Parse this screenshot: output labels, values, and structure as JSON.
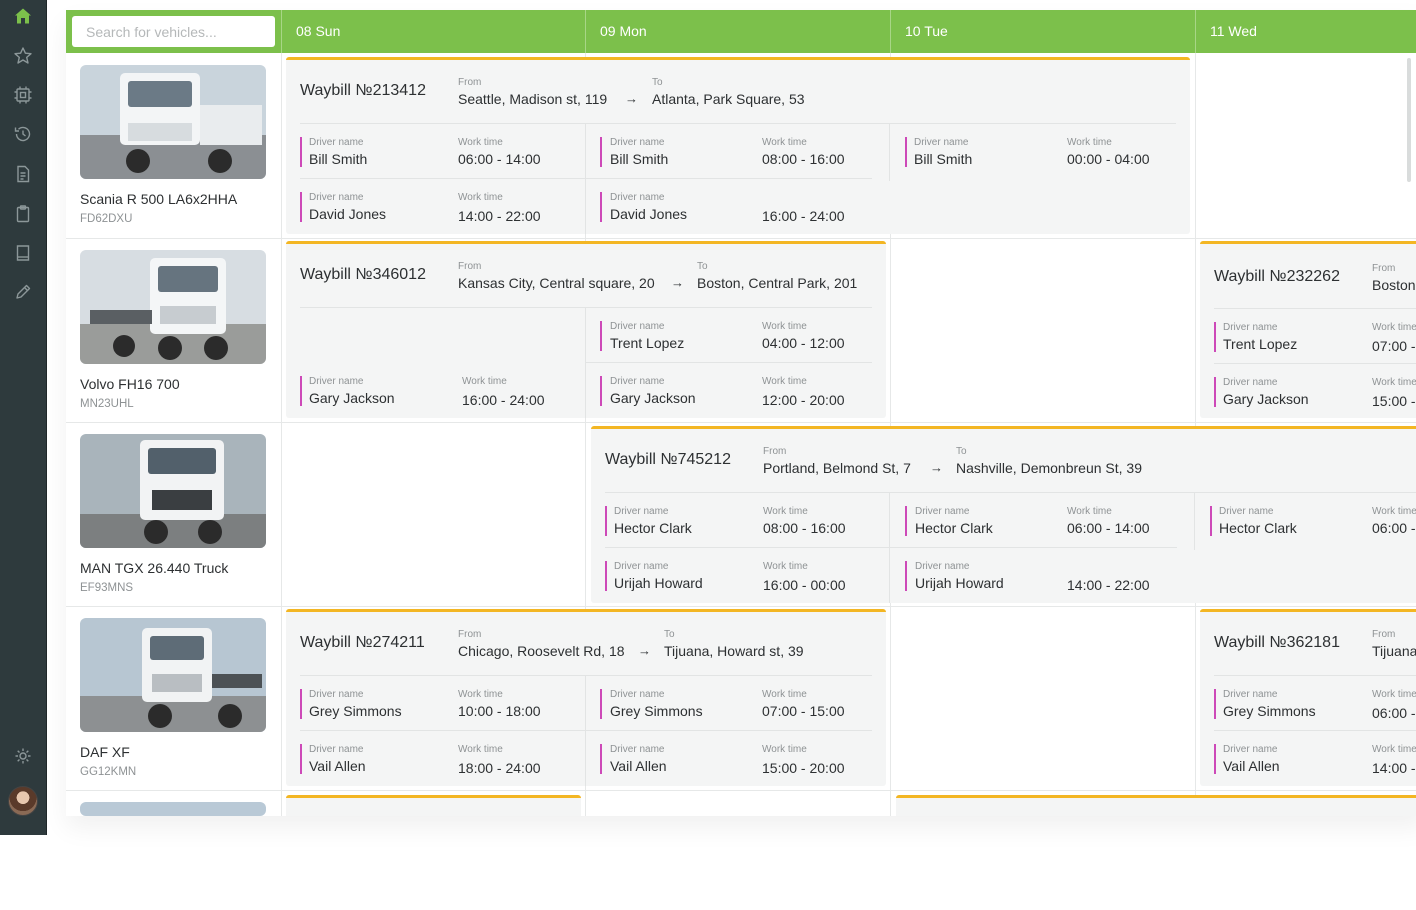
{
  "search": {
    "placeholder": "Search for vehicles..."
  },
  "days": [
    "08 Sun",
    "09 Mon",
    "10 Tue",
    "11 Wed"
  ],
  "labels": {
    "from": "From",
    "to": "To",
    "driver": "Driver name",
    "work": "Work time"
  },
  "colors": {
    "header": "#7cc04b",
    "accent": "#f3b623",
    "driver_bar": "#cd49b8",
    "sidebar": "#2e3a3d"
  },
  "sidebar_icons": [
    "home-icon",
    "star-icon",
    "chip-icon",
    "history-icon",
    "document-icon",
    "clipboard-icon",
    "book-icon",
    "pencil-icon",
    "settings-icon"
  ],
  "vehicles": [
    {
      "name": "Scania R 500 LA6x2HHA",
      "plate": "FD62DXU"
    },
    {
      "name": "Volvo FH16 700",
      "plate": "MN23UHL"
    },
    {
      "name": "MAN TGX 26.440 Truck",
      "plate": "EF93MNS"
    },
    {
      "name": "DAF XF",
      "plate": "GG12KMN"
    }
  ],
  "waybills": [
    {
      "title": "Waybill №213412",
      "from": "Seattle, Madison st, 119",
      "to": "Atlanta, Park Square, 53",
      "drivers": [
        {
          "name": "Bill Smith",
          "times": [
            "06:00 - 14:00",
            "08:00 - 16:00",
            "00:00 - 04:00"
          ]
        },
        {
          "name": "David Jones",
          "times": [
            "14:00 - 22:00",
            "16:00 - 24:00"
          ]
        }
      ]
    },
    {
      "title": "Waybill №346012",
      "from": "Kansas City, Central square, 20",
      "to": "Boston, Central Park, 201",
      "drivers": [
        {
          "name": "Trent Lopez",
          "times": [
            "04:00 - 12:00"
          ]
        },
        {
          "name": "Gary Jackson",
          "times": [
            "16:00 - 24:00",
            "12:00 - 20:00"
          ]
        }
      ]
    },
    {
      "title": "Waybill №232262",
      "from": "Boston",
      "drivers": [
        {
          "name": "Trent Lopez",
          "times": [
            "07:00 -"
          ]
        },
        {
          "name": "Gary Jackson",
          "times": [
            "15:00 -"
          ]
        }
      ]
    },
    {
      "title": "Waybill №745212",
      "from": "Portland, Belmond St, 7",
      "to": "Nashville, Demonbreun St, 39",
      "drivers": [
        {
          "name": "Hector Clark",
          "times": [
            "08:00 - 16:00",
            "06:00 - 14:00",
            "06:00 -"
          ]
        },
        {
          "name": "Urijah Howard",
          "times": [
            "16:00 - 00:00",
            "14:00 - 22:00"
          ]
        }
      ]
    },
    {
      "title": "Waybill №274211",
      "from": "Chicago, Roosevelt Rd, 18",
      "to": "Tijuana, Howard st, 39",
      "drivers": [
        {
          "name": "Grey Simmons",
          "times": [
            "10:00 - 18:00",
            "07:00 - 15:00"
          ]
        },
        {
          "name": "Vail Allen",
          "times": [
            "18:00 - 24:00",
            "15:00 - 20:00"
          ]
        }
      ]
    },
    {
      "title": "Waybill №362181",
      "from": "Tijuana",
      "drivers": [
        {
          "name": "Grey Simmons",
          "times": [
            "06:00 -"
          ]
        },
        {
          "name": "Vail Allen",
          "times": [
            "14:00 -"
          ]
        }
      ]
    }
  ]
}
